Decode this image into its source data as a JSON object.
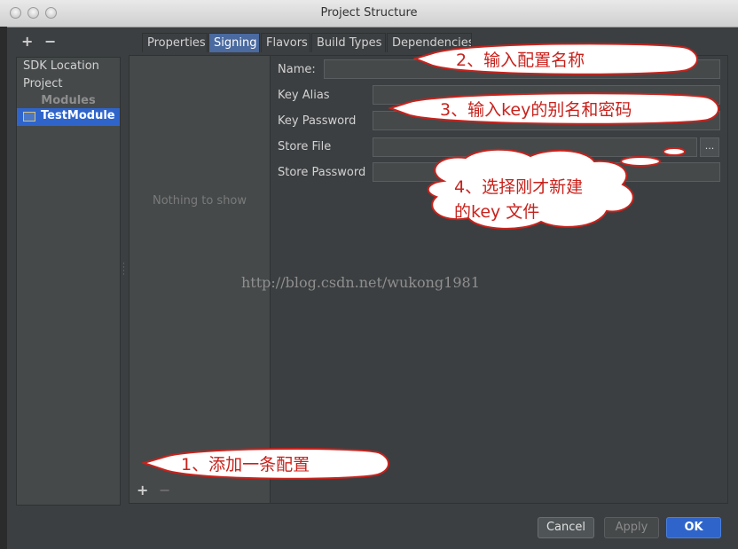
{
  "window": {
    "title": "Project Structure"
  },
  "toolbar": {
    "add": "+",
    "remove": "−"
  },
  "sidebar": {
    "items": [
      {
        "label": "SDK Location"
      },
      {
        "label": "Project"
      }
    ],
    "modules_header": "Modules",
    "selected_module": "TestModule"
  },
  "tabs": [
    {
      "label": "Properties"
    },
    {
      "label": "Signing"
    },
    {
      "label": "Flavors"
    },
    {
      "label": "Build Types"
    },
    {
      "label": "Dependencies"
    }
  ],
  "list": {
    "empty_text": "Nothing to show",
    "add": "+",
    "remove": "−"
  },
  "form": {
    "name_label": "Name:",
    "key_alias_label": "Key Alias",
    "key_password_label": "Key Password",
    "store_file_label": "Store File",
    "store_password_label": "Store Password",
    "browse_label": "..."
  },
  "buttons": {
    "cancel": "Cancel",
    "apply": "Apply",
    "ok": "OK"
  },
  "watermark": "http://blog.csdn.net/wukong1981",
  "annotations": {
    "step1": "1、添加一条配置",
    "step2": "2、输入配置名称",
    "step3": "3、输入key的别名和密码",
    "step4_line1": "4、选择刚才新建",
    "step4_line2": "的key 文件"
  },
  "colors": {
    "accent": "#2f65ca",
    "callout_text": "#c8221c",
    "callout_fill": "#ffffff",
    "callout_border": "#c8221c"
  }
}
